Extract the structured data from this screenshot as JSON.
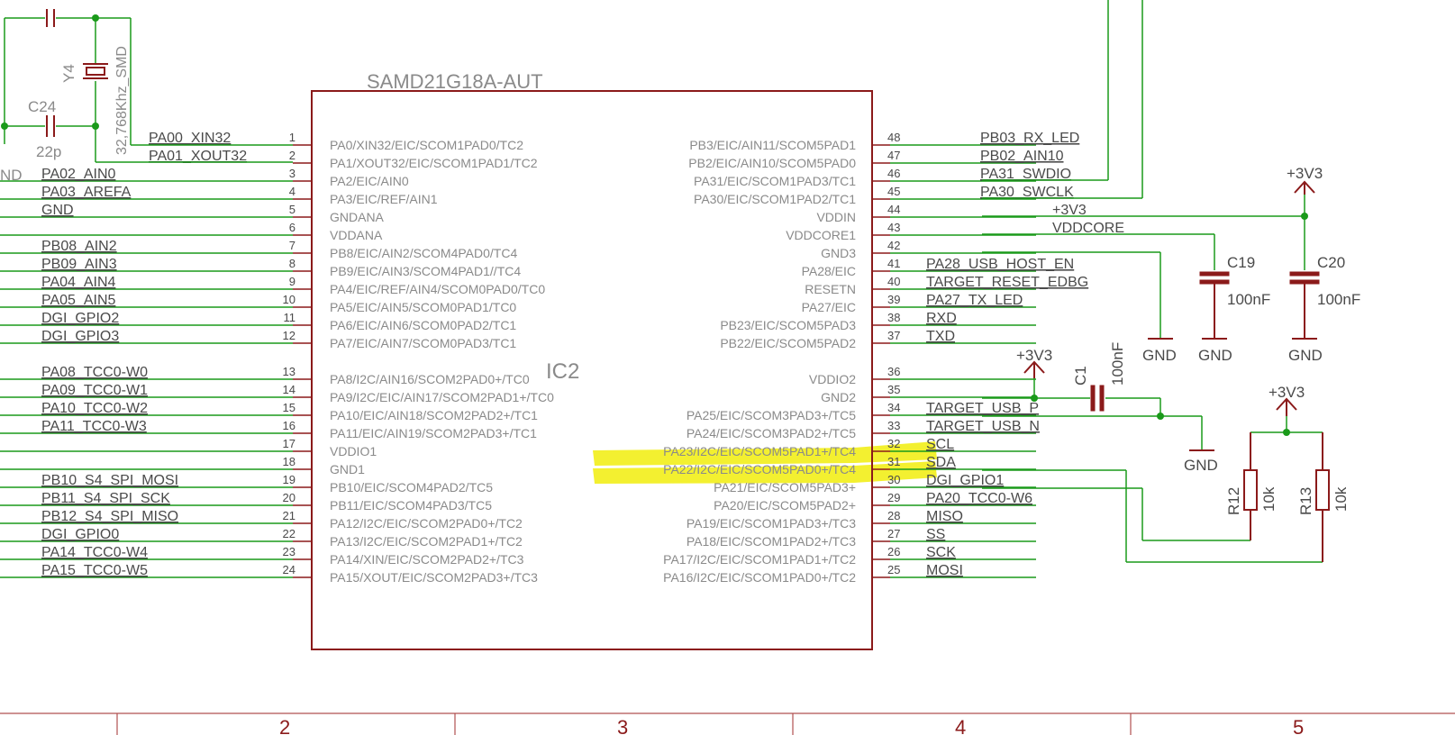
{
  "chip": {
    "name": "SAMD21G18A-AUT",
    "ref": "IC2",
    "left_pins": [
      {
        "num": "1",
        "pin": "PA0/XIN32/EIC/SCOM1PAD0/TC2",
        "net": "PA00_XIN32"
      },
      {
        "num": "2",
        "pin": "PA1/XOUT32/EIC/SCOM1PAD1/TC2",
        "net": "PA01_XOUT32"
      },
      {
        "num": "3",
        "pin": "PA2/EIC/AIN0",
        "net": "PA02_AIN0"
      },
      {
        "num": "4",
        "pin": "PA3/EIC/REF/AIN1",
        "net": "PA03_AREFA"
      },
      {
        "num": "5",
        "pin": "GNDANA",
        "net": "GND"
      },
      {
        "num": "6",
        "pin": "VDDANA",
        "net": ""
      },
      {
        "num": "7",
        "pin": "PB8/EIC/AIN2/SCOM4PAD0/TC4",
        "net": "PB08_AIN2"
      },
      {
        "num": "8",
        "pin": "PB9/EIC/AIN3/SCOM4PAD1//TC4",
        "net": "PB09_AIN3"
      },
      {
        "num": "9",
        "pin": "PA4/EIC/REF/AIN4/SCOM0PAD0/TC0",
        "net": "PA04_AIN4"
      },
      {
        "num": "10",
        "pin": "PA5/EIC/AIN5/SCOM0PAD1/TC0",
        "net": "PA05_AIN5"
      },
      {
        "num": "11",
        "pin": "PA6/EIC/AIN6/SCOM0PAD2/TC1",
        "net": "DGI_GPIO2"
      },
      {
        "num": "12",
        "pin": "PA7/EIC/AIN7/SCOM0PAD3/TC1",
        "net": "DGI_GPIO3"
      },
      {
        "num": "13",
        "pin": "PA8/I2C/AIN16/SCOM2PAD0+/TC0",
        "net": "PA08_TCC0-W0"
      },
      {
        "num": "14",
        "pin": "PA9/I2C/EIC/AIN17/SCOM2PAD1+/TC0",
        "net": "PA09_TCC0-W1"
      },
      {
        "num": "15",
        "pin": "PA10/EIC/AIN18/SCOM2PAD2+/TC1",
        "net": "PA10_TCC0-W2"
      },
      {
        "num": "16",
        "pin": "PA11/EIC/AIN19/SCOM2PAD3+/TC1",
        "net": "PA11_TCC0-W3"
      },
      {
        "num": "17",
        "pin": "VDDIO1",
        "net": ""
      },
      {
        "num": "18",
        "pin": "GND1",
        "net": ""
      },
      {
        "num": "19",
        "pin": "PB10/EIC/SCOM4PAD2/TC5",
        "net": "PB10_S4_SPI_MOSI"
      },
      {
        "num": "20",
        "pin": "PB11/EIC/SCOM4PAD3/TC5",
        "net": "PB11_S4_SPI_SCK"
      },
      {
        "num": "21",
        "pin": "PA12/I2C/EIC/SCOM2PAD0+/TC2",
        "net": "PB12_S4_SPI_MISO"
      },
      {
        "num": "22",
        "pin": "PA13/I2C/EIC/SCOM2PAD1+/TC2",
        "net": "DGI_GPIO0"
      },
      {
        "num": "23",
        "pin": "PA14/XIN/EIC/SCOM2PAD2+/TC3",
        "net": "PA14_TCC0-W4"
      },
      {
        "num": "24",
        "pin": "PA15/XOUT/EIC/SCOM2PAD3+/TC3",
        "net": "PA15_TCC0-W5"
      }
    ],
    "right_pins": [
      {
        "num": "48",
        "pin": "PB3/EIC/AIN11/SCOM5PAD1",
        "net": "PB03_RX_LED"
      },
      {
        "num": "47",
        "pin": "PB2/EIC/AIN10/SCOM5PAD0",
        "net": "PB02_AIN10"
      },
      {
        "num": "46",
        "pin": "PA31/EIC/SCOM1PAD3/TC1",
        "net": "PA31_SWDIO"
      },
      {
        "num": "45",
        "pin": "PA30/EIC/SCOM1PAD2/TC1",
        "net": "PA30_SWCLK"
      },
      {
        "num": "44",
        "pin": "VDDIN",
        "net": "+3V3"
      },
      {
        "num": "43",
        "pin": "VDDCORE1",
        "net": "VDDCORE"
      },
      {
        "num": "42",
        "pin": "GND3",
        "net": ""
      },
      {
        "num": "41",
        "pin": "PA28/EIC",
        "net": "PA28_USB_HOST_EN"
      },
      {
        "num": "40",
        "pin": "RESETN",
        "net": "TARGET_RESET_EDBG"
      },
      {
        "num": "39",
        "pin": "PA27/EIC",
        "net": "PA27_TX_LED"
      },
      {
        "num": "38",
        "pin": "PB23/EIC/SCOM5PAD3",
        "net": "RXD"
      },
      {
        "num": "37",
        "pin": "PB22/EIC/SCOM5PAD2",
        "net": "TXD"
      },
      {
        "num": "36",
        "pin": "VDDIO2",
        "net": ""
      },
      {
        "num": "35",
        "pin": "GND2",
        "net": ""
      },
      {
        "num": "34",
        "pin": "PA25/EIC/SCOM3PAD3+/TC5",
        "net": "TARGET_USB_P"
      },
      {
        "num": "33",
        "pin": "PA24/EIC/SCOM3PAD2+/TC5",
        "net": "TARGET_USB_N"
      },
      {
        "num": "32",
        "pin": "PA23/I2C/EIC/SCOM5PAD1+/TC4",
        "net": "SCL"
      },
      {
        "num": "31",
        "pin": "PA22/I2C/EIC/SCOM5PAD0+/TC4",
        "net": "SDA"
      },
      {
        "num": "30",
        "pin": "PA21/EIC/SCOM5PAD3+",
        "net": "DGI_GPIO1"
      },
      {
        "num": "29",
        "pin": "PA20/EIC/SCOM5PAD2+",
        "net": "PA20_TCC0-W6"
      },
      {
        "num": "28",
        "pin": "PA19/EIC/SCOM1PAD3+/TC3",
        "net": "MISO"
      },
      {
        "num": "27",
        "pin": "PA18/EIC/SCOM1PAD2+/TC3",
        "net": "SS"
      },
      {
        "num": "26",
        "pin": "PA17/I2C/EIC/SCOM1PAD1+/TC2",
        "net": "SCK"
      },
      {
        "num": "25",
        "pin": "PA16/I2C/EIC/SCOM1PAD0+/TC2",
        "net": "MOSI"
      }
    ]
  },
  "crystal": {
    "ref": "Y4",
    "value": "32,768Khz_SMD",
    "cap_ref": "C24",
    "cap_value": "22p",
    "gnd_label": "ND"
  },
  "decoupling": [
    {
      "ref": "C19",
      "value": "100nF",
      "gnd": "GND"
    },
    {
      "ref": "C20",
      "value": "100nF",
      "gnd": "GND"
    }
  ],
  "c1": {
    "ref": "C1",
    "value": "100nF",
    "power": "+3V3",
    "gnd": "GND"
  },
  "pullups": [
    {
      "ref": "R12",
      "value": "10k"
    },
    {
      "ref": "R13",
      "value": "10k"
    }
  ],
  "power_labels": {
    "vcc": "+3V3",
    "gnd": "GND"
  },
  "gnd42_label": "GND",
  "frame_columns": [
    "2",
    "3",
    "4",
    "5"
  ],
  "highlight_color": "#f2ee1a",
  "wire_color": "#1a9a1a",
  "part_color": "#8b1a1a"
}
